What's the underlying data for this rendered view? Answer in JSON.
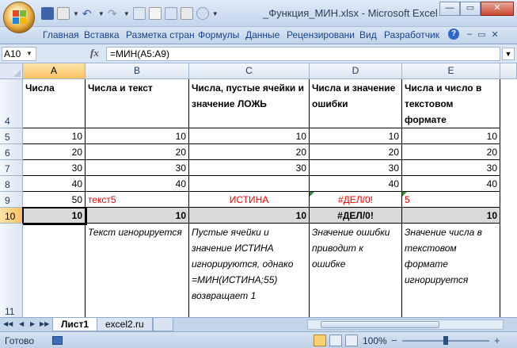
{
  "window": {
    "title": "_Функция_МИН.xlsx - Microsoft Excel",
    "minimize": "—",
    "restore": "▭",
    "close": "✕"
  },
  "ribbon": {
    "tabs": [
      "Главная",
      "Вставка",
      "Разметка стран",
      "Формулы",
      "Данные",
      "Рецензировани",
      "Вид",
      "Разработчик"
    ],
    "help": "?",
    "doc_controls": [
      "–",
      "▭",
      "✕"
    ]
  },
  "formula_bar": {
    "name_box": "A10",
    "fx": "fx",
    "formula": "=МИН(A5:A9)"
  },
  "columns": [
    "A",
    "B",
    "C",
    "D",
    "E"
  ],
  "selected_column": "A",
  "rows": [
    {
      "num": "4",
      "cells": [
        "Числа",
        "Числа и текст",
        "Числа, пустые ячейки и значение ЛОЖЬ",
        "Числа и значение ошибки",
        "Числа и число в текстовом формате"
      ]
    },
    {
      "num": "5",
      "cells": [
        "10",
        "10",
        "10",
        "10",
        "10"
      ]
    },
    {
      "num": "6",
      "cells": [
        "20",
        "20",
        "20",
        "20",
        "20"
      ]
    },
    {
      "num": "7",
      "cells": [
        "30",
        "30",
        "30",
        "30",
        "30"
      ]
    },
    {
      "num": "8",
      "cells": [
        "40",
        "40",
        "",
        "40",
        "40"
      ]
    },
    {
      "num": "9",
      "cells": [
        "50",
        "текст5",
        "ИСТИНА",
        "#ДЕЛ/0!",
        "5"
      ]
    },
    {
      "num": "10",
      "cells": [
        "10",
        "10",
        "10",
        "#ДЕЛ/0!",
        "10"
      ]
    },
    {
      "num": "11",
      "cells": [
        "",
        "Текст игнорируется",
        "Пустые ячейки и значение ИСТИНА игнорируются, однако =МИН(ИСТИНА;55) возвращает 1",
        "Значение ошибки приводит к ошибке",
        "Значение числа в текстовом формате игнорируется"
      ]
    }
  ],
  "selected_row": "10",
  "sheets": [
    "Лист1",
    "excel2.ru"
  ],
  "active_sheet": "Лист1",
  "status": {
    "text": "Готово",
    "zoom": "100%",
    "zoom_minus": "−",
    "zoom_plus": "+"
  },
  "colors": {
    "error_text": "#ff0000",
    "total_row_fill": "#d9d9d9",
    "selection_header": "#f8c162"
  }
}
